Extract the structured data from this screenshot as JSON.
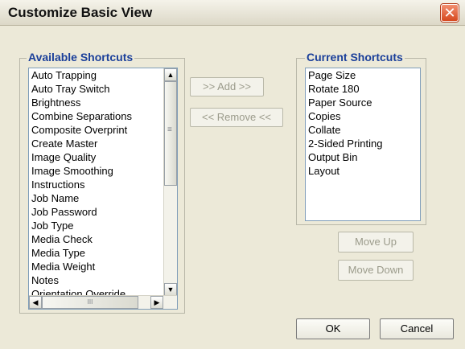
{
  "window": {
    "title": "Customize Basic View",
    "close_glyph": "✕"
  },
  "available": {
    "label": "Available Shortcuts",
    "items": [
      "Auto Trapping",
      "Auto Tray Switch",
      "Brightness",
      "Combine Separations",
      "Composite Overprint",
      "Create Master",
      "Image Quality",
      "Image Smoothing",
      "Instructions",
      "Job Name",
      "Job Password",
      "Job Type",
      "Media Check",
      "Media Type",
      "Media Weight",
      "Notes",
      "Orientation Override"
    ],
    "hscroll_glyph": "III"
  },
  "current": {
    "label": "Current Shortcuts",
    "items": [
      "Page Size",
      "Rotate 180",
      "Paper Source",
      "Copies",
      "Collate",
      "2-Sided Printing",
      "Output Bin",
      "Layout"
    ]
  },
  "buttons": {
    "add": ">> Add >>",
    "remove": "<< Remove <<",
    "move_up": "Move Up",
    "move_down": "Move Down",
    "ok": "OK",
    "cancel": "Cancel"
  },
  "icons": {
    "up_arrow": "▲",
    "down_arrow": "▼",
    "left_arrow": "◀",
    "right_arrow": "▶",
    "grip": "≡"
  }
}
